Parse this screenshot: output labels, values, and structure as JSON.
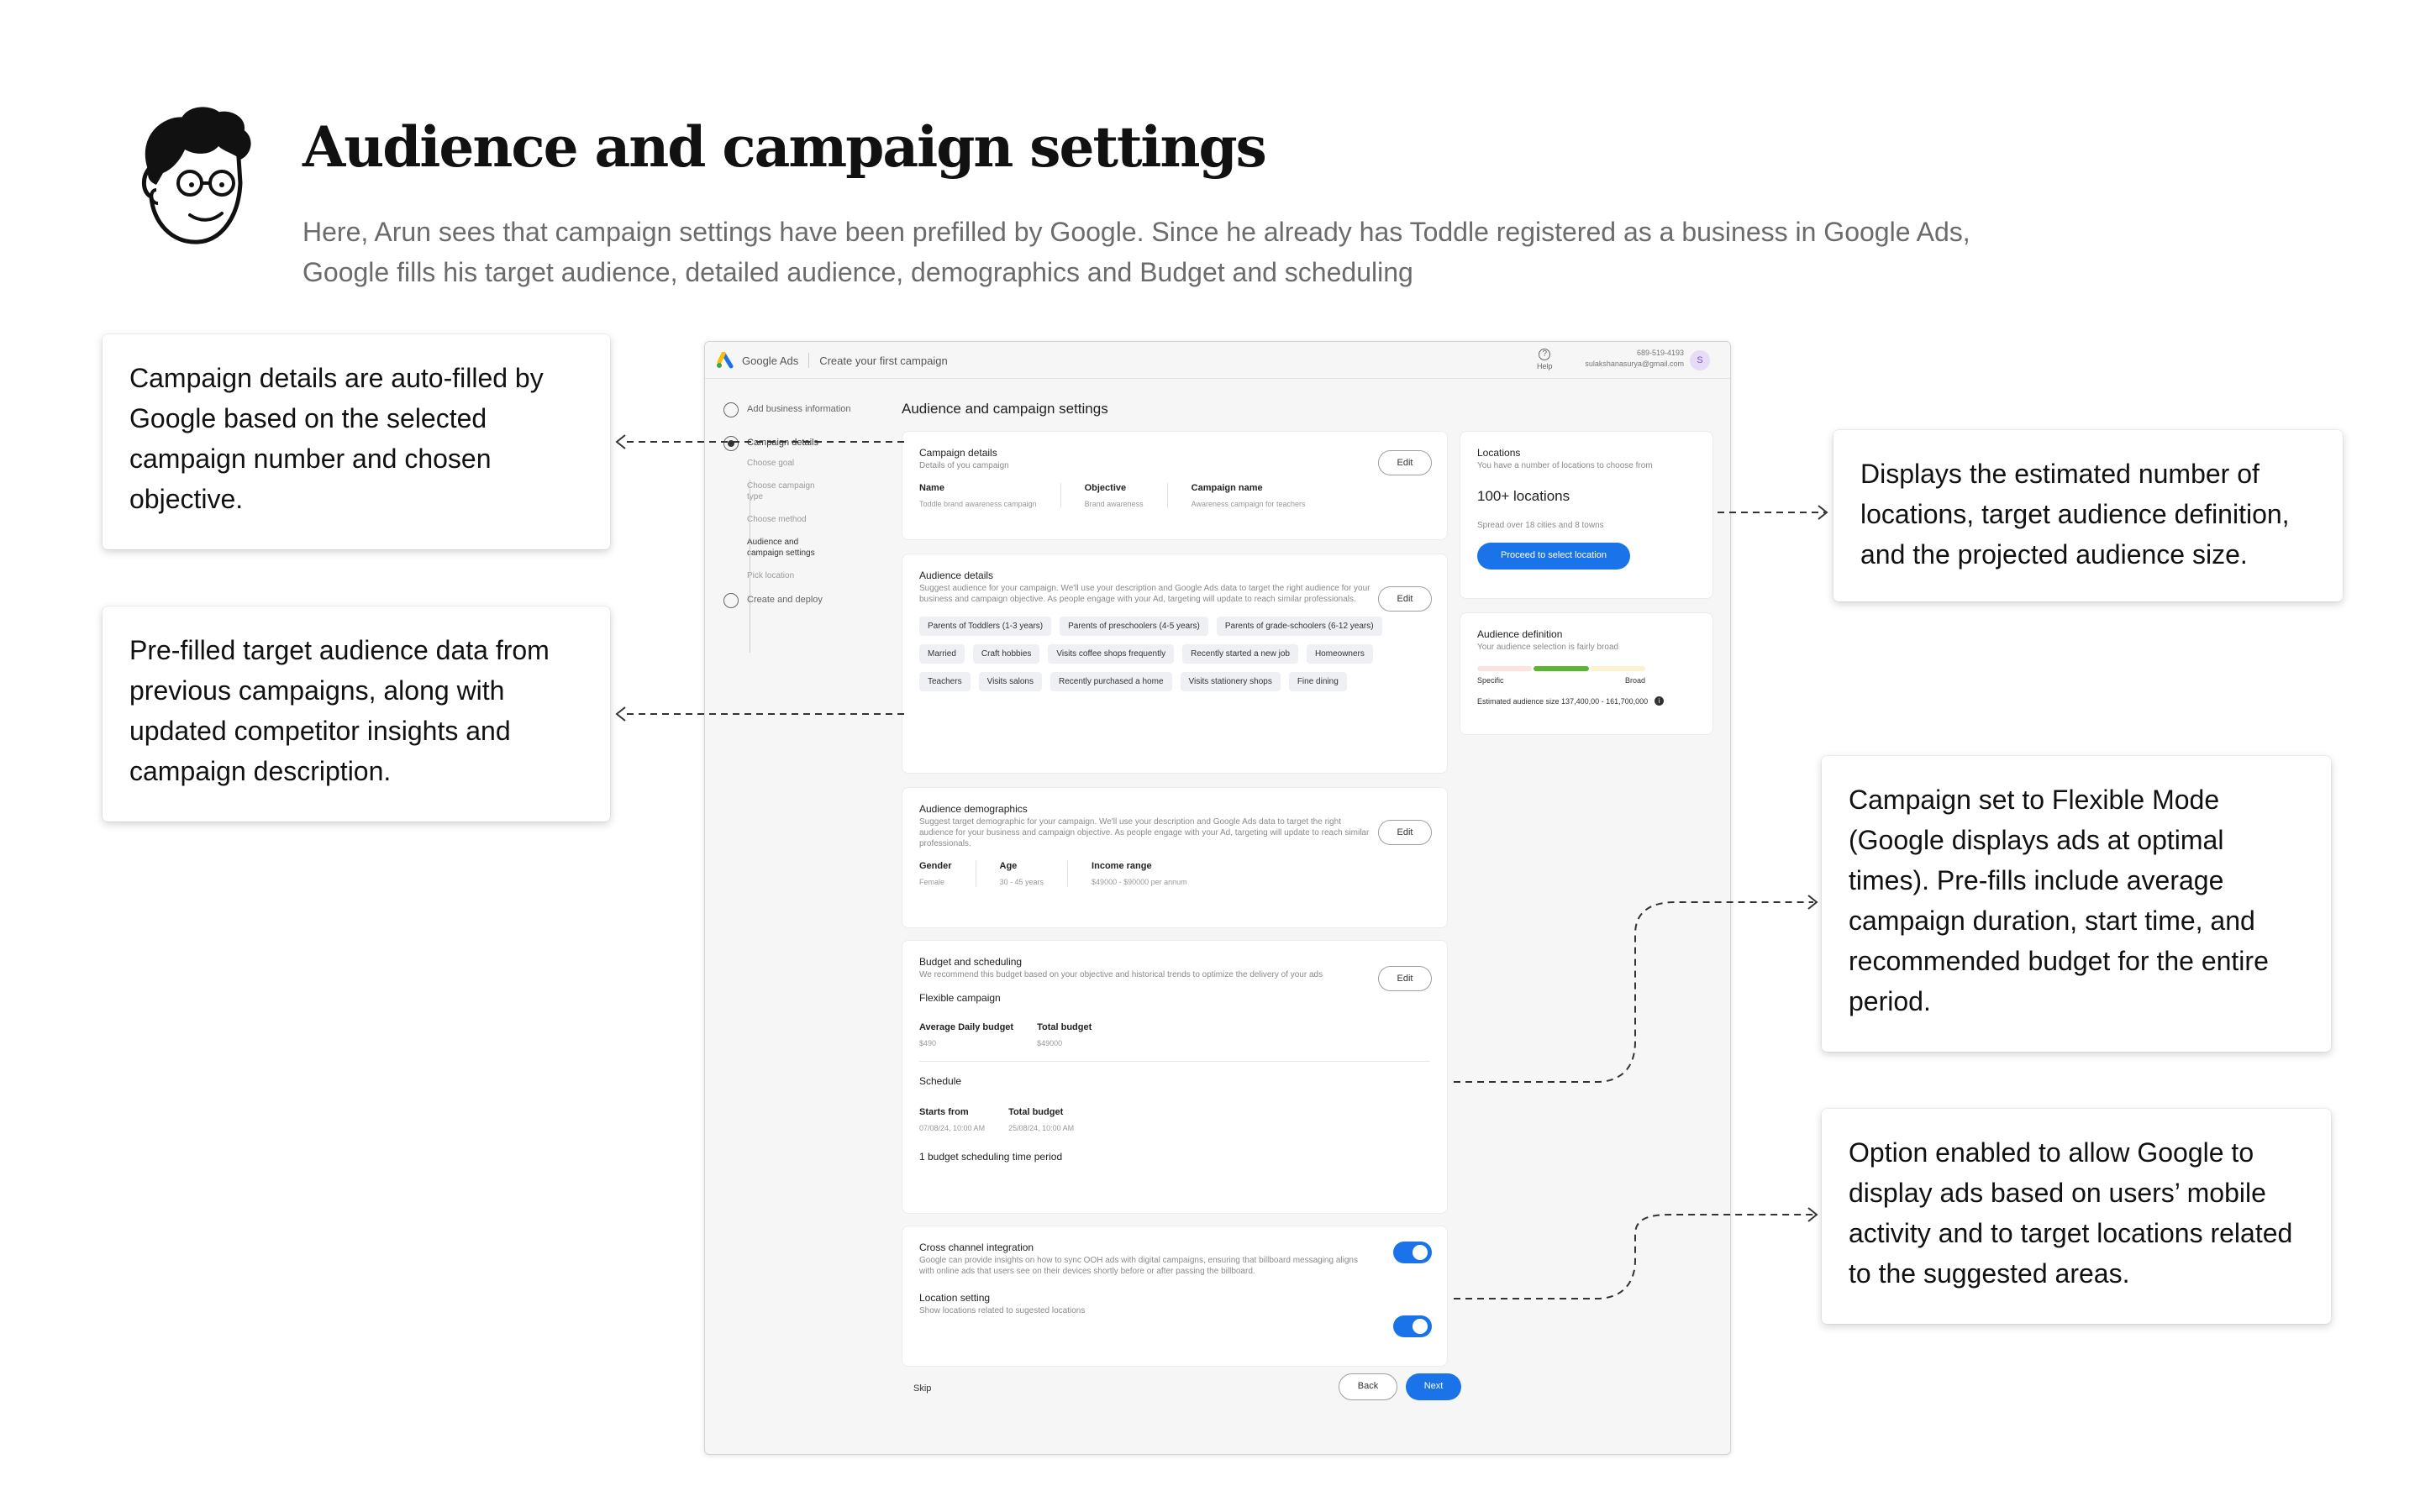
{
  "header": {
    "title": "Audience and campaign settings",
    "intro": "Here, Arun sees that campaign settings have been prefilled by Google. Since he already has Toddle registered as a business in Google Ads, Google fills his target audience, detailed audience, demographics and Budget and scheduling"
  },
  "callouts": {
    "campaign_details": "Campaign details are auto-filled by Google based on the selected campaign number and chosen objective.",
    "audience_data": "Pre-filled target audience data from previous campaigns, along with updated competitor insights and campaign description.",
    "locations": "Displays the estimated number of locations, target audience definition, and the projected audience size.",
    "flexible_mode": "Campaign set to Flexible Mode (Google displays ads at optimal times). Pre-fills include average campaign duration, start time, and recommended budget for the entire period.",
    "mobile_option": "Option enabled to allow Google to display ads based on users’ mobile activity and to target locations related to the suggested areas."
  },
  "app": {
    "brand": "Google Ads",
    "page": "Create your first campaign",
    "help": "Help",
    "phone": "689-519-4193",
    "email": "sulakshanasurya@gmail.com",
    "avatar_letter": "S",
    "steps": {
      "add_business": "Add business information",
      "campaign_details": "Campaign details",
      "choose_goal": "Choose goal",
      "choose_type": "Choose campaign type",
      "choose_method": "Choose method",
      "audience_settings": "Audience and campaign settings",
      "pick_location": "Pick location",
      "create_deploy": "Create and deploy"
    },
    "main_title": "Audience and campaign settings",
    "edit": "Edit",
    "campaign_card": {
      "title": "Campaign details",
      "subtitle": "Details of you campaign",
      "fields": [
        {
          "label": "Name",
          "value": "Toddle brand awareness campaign"
        },
        {
          "label": "Objective",
          "value": "Brand awareness"
        },
        {
          "label": "Campaign name",
          "value": "Awareness campaign for teachers"
        }
      ]
    },
    "audience_card": {
      "title": "Audience details",
      "subtitle": "Suggest audience for your campaign. We'll use your description and Google Ads data to target the right audience for your business and campaign objective. As people engage with your Ad, targeting will update to reach similar professionals.",
      "chips": [
        "Parents of Toddlers (1-3 years)",
        "Parents of preschoolers (4-5 years)",
        "Parents of grade-schoolers (6-12 years)",
        "Married",
        "Craft hobbies",
        "Visits coffee shops frequently",
        "Recently started a new job",
        "Homeowners",
        "Teachers",
        "Visits salons",
        "Recently purchased a home",
        "Visits stationery shops",
        "Fine dining"
      ]
    },
    "demographics_card": {
      "title": "Audience demographics",
      "subtitle": "Suggest target demographic for your campaign. We'll use your description and Google Ads data to target the right audience for your business and campaign objective. As people engage with your Ad, targeting will update to reach similar professionals.",
      "fields": [
        {
          "label": "Gender",
          "value": "Female"
        },
        {
          "label": "Age",
          "value": "30 - 45 years"
        },
        {
          "label": "Income range",
          "value": "$49000 - $90000 per annum"
        }
      ]
    },
    "budget_card": {
      "title": "Budget and scheduling",
      "subtitle": "We recommend this budget based on your objective and historical trends to optimize the delivery of your ads",
      "mode": "Flexible campaign",
      "budget_fields": [
        {
          "label": "Average Daily budget",
          "value": "$490"
        },
        {
          "label": "Total budget",
          "value": "$49000"
        }
      ],
      "schedule_title": "Schedule",
      "schedule_fields": [
        {
          "label": "Starts from",
          "value": "07/08/24, 10:00 AM"
        },
        {
          "label": "Total budget",
          "value": "25/08/24, 10:00 AM"
        }
      ],
      "periods": "1 budget scheduling time period"
    },
    "toggles_card": {
      "cross_title": "Cross channel integration",
      "cross_desc": "Google can provide insights on how to sync OOH ads with digital campaigns, ensuring that billboard messaging aligns with online ads that users see on their devices shortly before or after passing the billboard.",
      "location_title": "Location setting",
      "location_desc": "Show locations related to sugested locations",
      "cross_enabled": true,
      "location_enabled": true
    },
    "locations_card": {
      "title": "Locations",
      "subtitle": "You have a number of locations to choose from",
      "count": "100+ locations",
      "spread": "Spread over 18 cities and 8 towns",
      "button": "Proceed to select location"
    },
    "definition_card": {
      "title": "Audience definition",
      "subtitle": "Your audience selection is fairly broad",
      "specific": "Specific",
      "broad": "Broad",
      "estimate": "Estimated audience size 137,400,00 - 161,700,000",
      "info_icon": "i"
    },
    "footer": {
      "skip": "Skip",
      "back": "Back",
      "next": "Next"
    },
    "colors": {
      "primary": "#1a73e8",
      "meter_green": "#34a853",
      "meter_red": "#ea4335",
      "meter_yellow": "#fbbc04"
    }
  }
}
